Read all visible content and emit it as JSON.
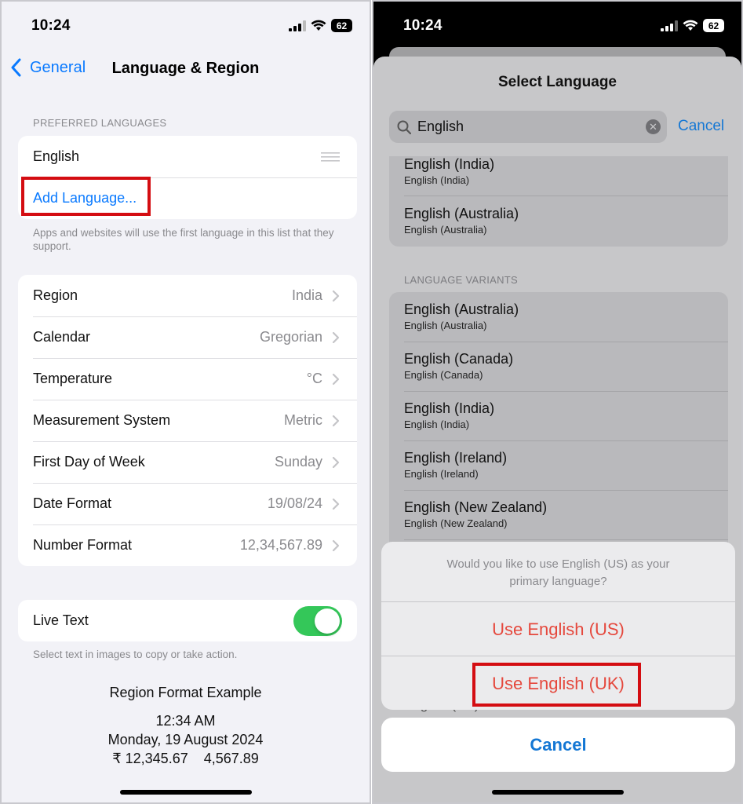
{
  "left": {
    "status": {
      "time": "10:24",
      "battery": "62"
    },
    "nav": {
      "back_label": "General",
      "title": "Language & Region"
    },
    "preferred": {
      "header": "PREFERRED LANGUAGES",
      "language": "English",
      "add_label": "Add Language...",
      "footnote": "Apps and websites will use the first language in this list that they support."
    },
    "settings": [
      {
        "label": "Region",
        "value": "India"
      },
      {
        "label": "Calendar",
        "value": "Gregorian"
      },
      {
        "label": "Temperature",
        "value": "°C"
      },
      {
        "label": "Measurement System",
        "value": "Metric"
      },
      {
        "label": "First Day of Week",
        "value": "Sunday"
      },
      {
        "label": "Date Format",
        "value": "19/08/24"
      },
      {
        "label": "Number Format",
        "value": "12,34,567.89"
      }
    ],
    "live_text": {
      "label": "Live Text",
      "on": true,
      "footnote": "Select text in images to copy or take action."
    },
    "example": {
      "title": "Region Format Example",
      "time": "12:34 AM",
      "date": "Monday, 19 August 2024",
      "numbers": "₹ 12,345.67    4,567.89"
    }
  },
  "right": {
    "status": {
      "time": "10:24",
      "battery": "62"
    },
    "sheet_title": "Select Language",
    "search": {
      "value": "English",
      "cancel_label": "Cancel"
    },
    "results": [
      {
        "name": "English (India)",
        "native": "English (India)"
      },
      {
        "name": "English (Australia)",
        "native": "English (Australia)"
      }
    ],
    "variants_header": "LANGUAGE VARIANTS",
    "variants": [
      {
        "name": "English (Australia)",
        "native": "English (Australia)"
      },
      {
        "name": "English (Canada)",
        "native": "English (Canada)"
      },
      {
        "name": "English (India)",
        "native": "English (India)"
      },
      {
        "name": "English (Ireland)",
        "native": "English (Ireland)"
      },
      {
        "name": "English (New Zealand)",
        "native": "English (New Zealand)"
      }
    ],
    "peek_text": "English (US)",
    "action_sheet": {
      "message_line1": "Would you like to use English (US) as your",
      "message_line2": "primary language?",
      "option_us": "Use English (US)",
      "option_uk": "Use English (UK)",
      "cancel_label": "Cancel"
    }
  },
  "colors": {
    "accent": "#0a7aff",
    "destructive": "#e5483d",
    "toggle_on": "#34c759",
    "highlight_box": "#d40d12"
  }
}
